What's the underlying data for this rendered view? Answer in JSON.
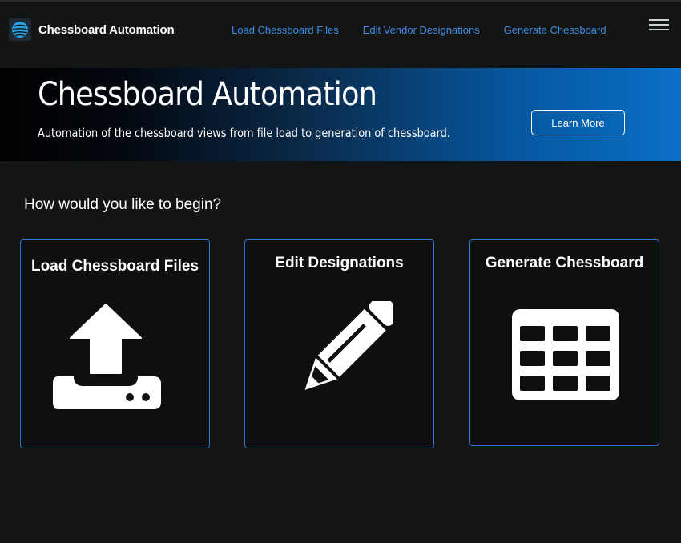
{
  "navbar": {
    "brand_title": "Chessboard Automation",
    "logo_icon": "globe-logo-icon",
    "links": [
      {
        "label": "Load Chessboard Files"
      },
      {
        "label": "Edit Vendor Designations"
      },
      {
        "label": "Generate Chessboard"
      }
    ],
    "menu_icon": "hamburger-menu-icon"
  },
  "hero": {
    "title": "Chessboard Automation",
    "subtitle": "Automation of the chessboard views from file load to generation of chessboard.",
    "button_label": "Learn More"
  },
  "main": {
    "prompt": "How would you like to begin?",
    "cards": [
      {
        "title": "Load Chessboard Files",
        "icon": "upload-icon"
      },
      {
        "title": "Edit Designations",
        "icon": "pencil-icon"
      },
      {
        "title": "Generate Chessboard",
        "icon": "grid-table-icon"
      }
    ]
  },
  "colors": {
    "accent": "#3b8ee8",
    "card_border": "#2e72c9",
    "background": "#131414"
  }
}
